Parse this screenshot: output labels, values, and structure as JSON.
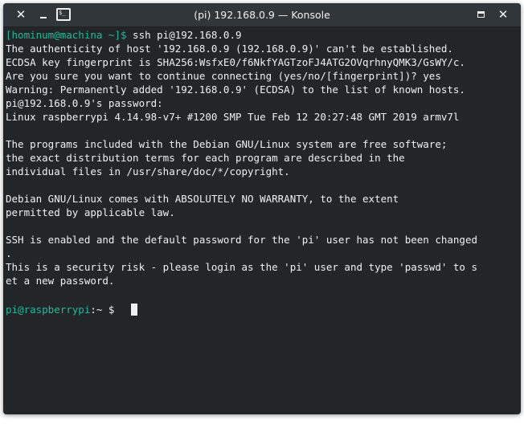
{
  "window": {
    "title": "(pi) 192.168.0.9 — Konsole",
    "close_glyph": "✕",
    "app_icon_label": "$_"
  },
  "terminal": {
    "line1": {
      "prompt": "[hominum@machina ~]$",
      "cmd": " ssh pi@192.168.0.9"
    },
    "lines": [
      "The authenticity of host '192.168.0.9 (192.168.0.9)' can't be established.",
      "ECDSA key fingerprint is SHA256:WsfxE0/f6NkfYAGTzoFJ4ATG2OVqrhnyQMK3/GsWY/c.",
      "Are you sure you want to continue connecting (yes/no/[fingerprint])? yes",
      "Warning: Permanently added '192.168.0.9' (ECDSA) to the list of known hosts.",
      "pi@192.168.0.9's password:",
      "Linux raspberrypi 4.14.98-v7+ #1200 SMP Tue Feb 12 20:27:48 GMT 2019 armv7l",
      "",
      "The programs included with the Debian GNU/Linux system are free software;",
      "the exact distribution terms for each program are described in the",
      "individual files in /usr/share/doc/*/copyright.",
      "",
      "Debian GNU/Linux comes with ABSOLUTELY NO WARRANTY, to the extent",
      "permitted by applicable law.",
      "",
      "SSH is enabled and the default password for the 'pi' user has not been changed",
      ".",
      "This is a security risk - please login as the 'pi' user and type 'passwd' to s",
      "et a new password.",
      ""
    ],
    "final_prompt": {
      "user_host": "pi@raspberrypi",
      "rest": ":~ $ "
    }
  },
  "colors": {
    "background": "#232629",
    "titlebar": "#31363b",
    "text": "#eff0f1",
    "prompt_accent": "#1abc9c"
  }
}
